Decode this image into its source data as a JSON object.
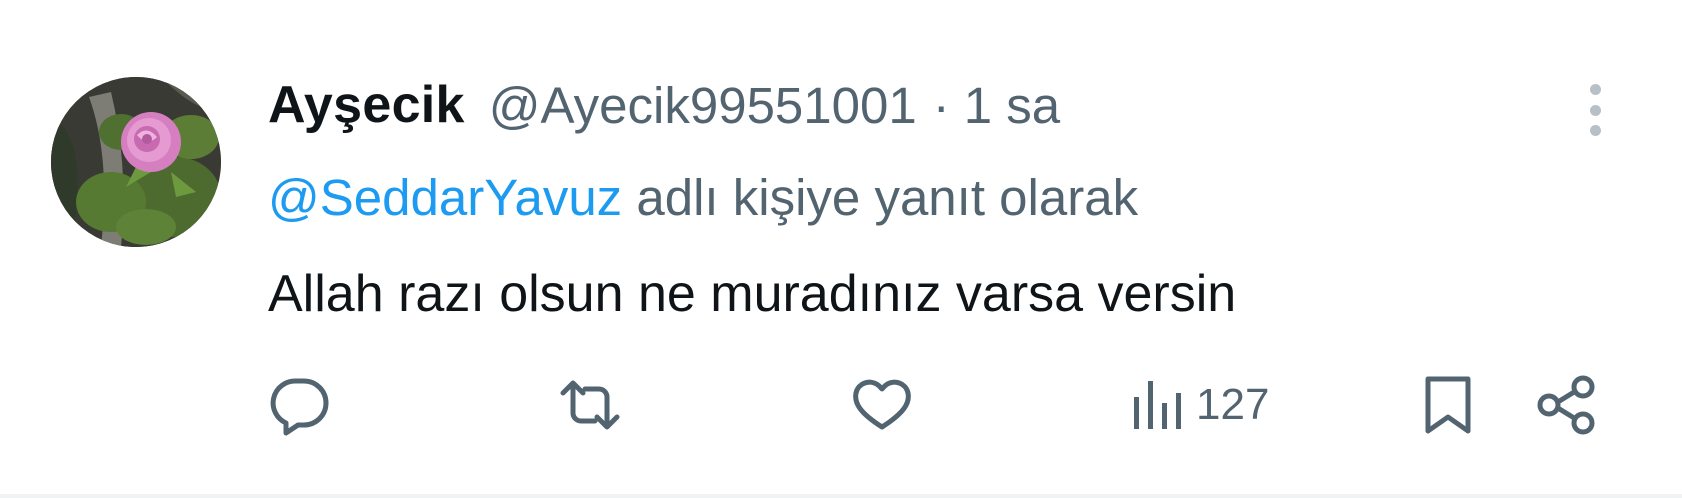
{
  "tweet": {
    "author_name": "Ayşecik",
    "author_handle": "@Ayecik99551001",
    "separator": "·",
    "time_ago": "1 sa",
    "reply_to_handle": "@SeddarYavuz",
    "reply_to_suffix": " adlı kişiye yanıt olarak",
    "text": "Allah razı olsun ne muradınız varsa versin"
  },
  "actions": {
    "reply_icon": "speech-bubble",
    "retweet_icon": "retweet-arrows",
    "like_icon": "heart",
    "views_icon": "bar-chart",
    "views_count": "127",
    "bookmark_icon": "bookmark",
    "share_icon": "share-nodes"
  },
  "colors": {
    "name": "#0f1419",
    "secondary": "#536471",
    "link": "#1d9bf0",
    "icon": "#536471"
  }
}
